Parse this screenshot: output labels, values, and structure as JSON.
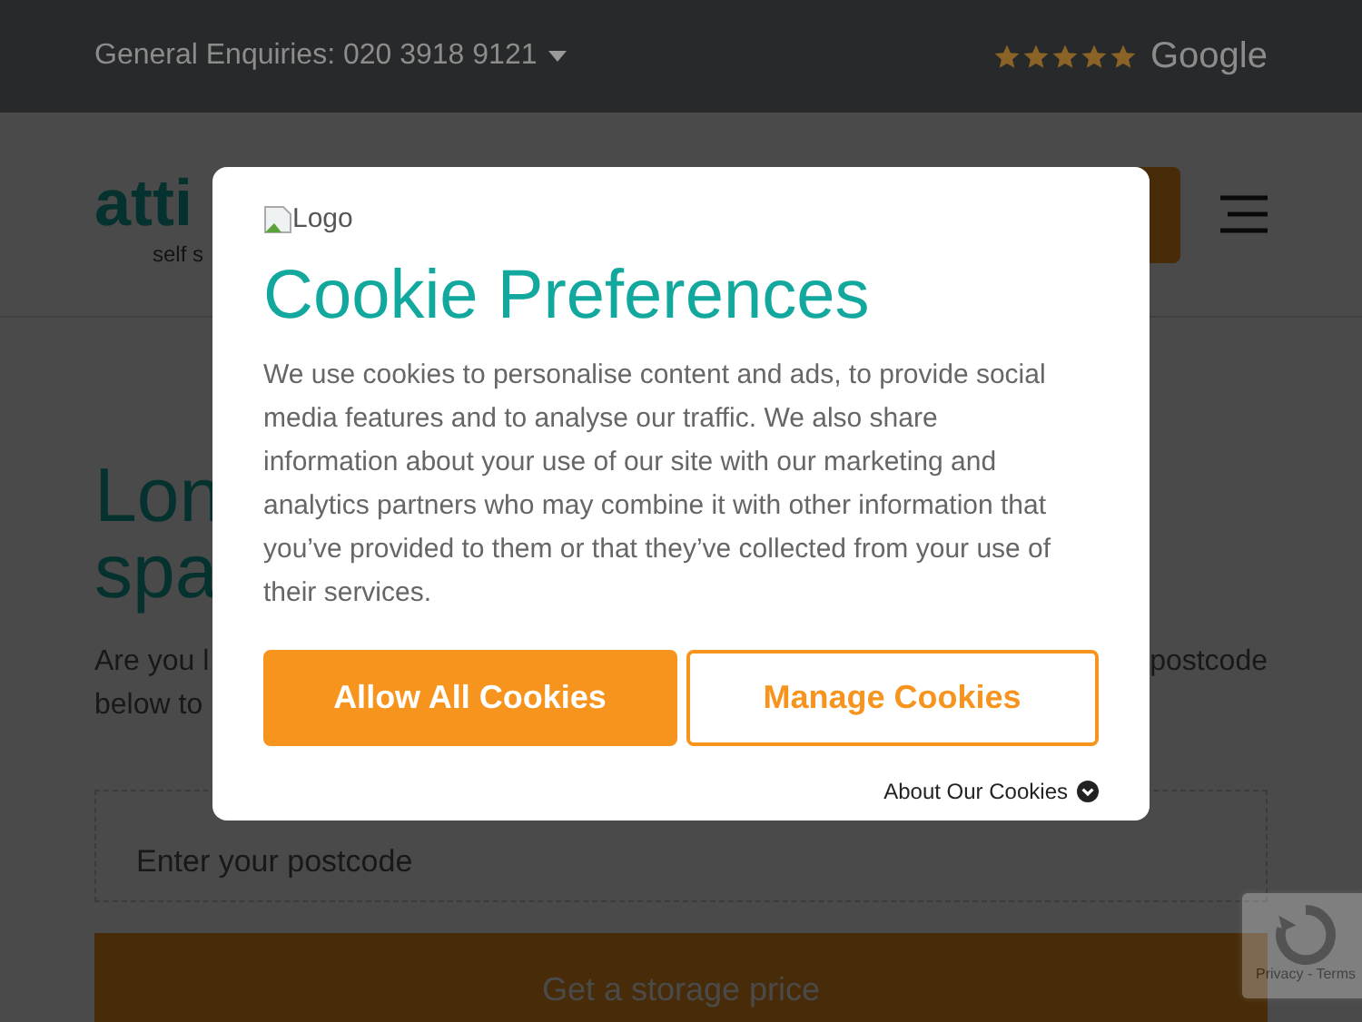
{
  "top_bar": {
    "enquiries": "General Enquiries: 020 3918 9121",
    "stars": 5,
    "brand": "Google"
  },
  "header": {
    "logo_text": "atti",
    "logo_tagline": "self s"
  },
  "hero": {
    "heading_lines": [
      "Lon",
      "spa"
    ],
    "intro_line_1_left": "Are you l",
    "intro_line_1_right": "postcode",
    "intro_line_2": "below to",
    "postcode_field": {
      "placeholder": "Enter your postcode"
    },
    "submit": "Get a storage price"
  },
  "recaptcha": {
    "text": "Privacy - Terms"
  },
  "cookie_dialog": {
    "logo_alt": "Logo",
    "title": "Cookie Preferences",
    "body": "We use cookies to personalise content and ads, to provide social media features and to analyse our traffic. We also share information about your use of our site with our marketing and analytics partners who may combine it with other information that you’ve provided to them or that they’ve collected from your use of their services.",
    "buttons": [
      {
        "label": "Allow All Cookies",
        "kind": "primary"
      },
      {
        "label": "Manage Cookies",
        "kind": "secondary"
      }
    ],
    "about_link": "About Our Cookies"
  }
}
